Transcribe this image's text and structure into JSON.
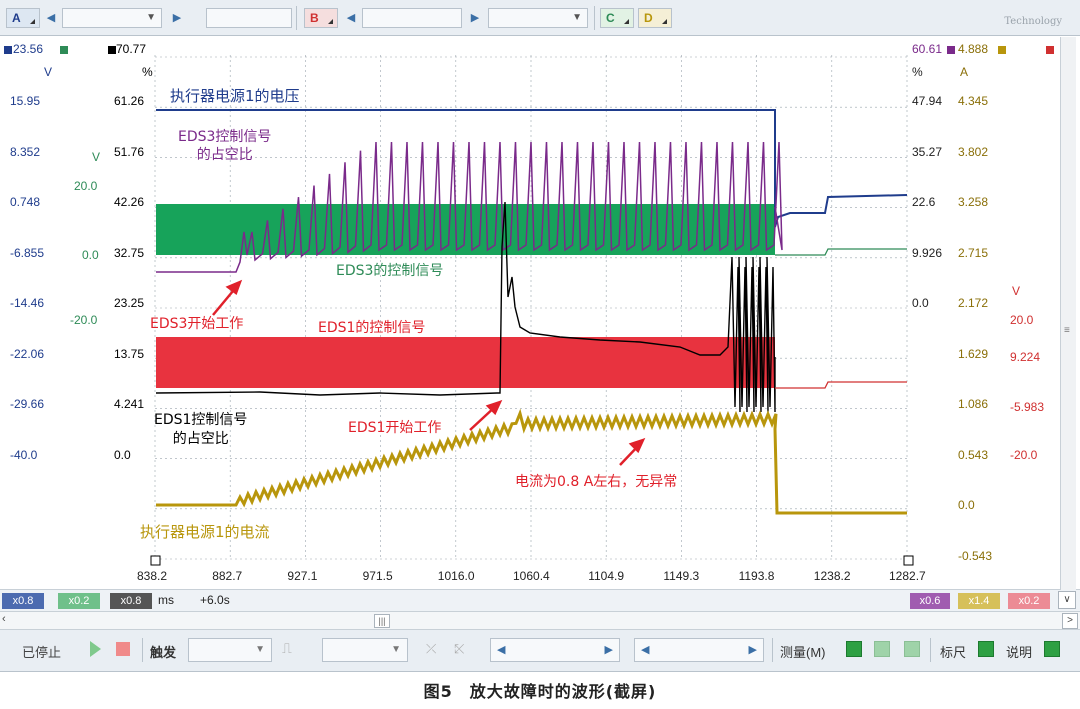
{
  "toolbar": {
    "ch_a": "A",
    "ch_b": "B",
    "ch_c": "C",
    "ch_d": "D",
    "brand": "Technology"
  },
  "axes": {
    "left1": {
      "unit": "V",
      "top": "23.56",
      "ticks": [
        "15.95",
        "8.352",
        "0.748",
        "-6.855",
        "-14.46",
        "-22.06",
        "-29.66",
        "-40.0"
      ],
      "color": "#1f3c8c"
    },
    "left2": {
      "unit": "V",
      "ticks": [
        "20.0",
        "0.0",
        "-20.0"
      ],
      "color": "#2e8b57"
    },
    "left3": {
      "unit": "%",
      "top": "70.77",
      "ticks": [
        "61.26",
        "51.76",
        "42.26",
        "32.75",
        "23.25",
        "13.75",
        "4.241",
        "0.0"
      ],
      "color": "#000000"
    },
    "right1": {
      "unit": "%",
      "top": "60.61",
      "ticks": [
        "47.94",
        "35.27",
        "22.6",
        "9.926",
        "0.0"
      ],
      "color": "#7a2a8a"
    },
    "right2": {
      "unit": "A",
      "top": "4.888",
      "ticks": [
        "4.345",
        "3.802",
        "3.258",
        "2.715",
        "2.172",
        "1.629",
        "1.086",
        "0.543",
        "0.0",
        "-0.543"
      ],
      "color": "#b8960c"
    },
    "right3": {
      "unit": "V",
      "ticks": [
        "20.0",
        "9.224",
        "-5.983",
        "-20.0"
      ],
      "color": "#d03030"
    },
    "x": {
      "ticks": [
        "838.2",
        "882.7",
        "927.1",
        "971.5",
        "1016.0",
        "1060.4",
        "1104.9",
        "1149.3",
        "1193.8",
        "1238.2",
        "1282.7"
      ]
    }
  },
  "annotations": {
    "voltage": "执行器电源1的电压",
    "eds3_duty": "EDS3控制信号\n的占空比",
    "eds3_ctrl": "EDS3的控制信号",
    "eds3_start": "EDS3开始工作",
    "eds1_ctrl": "EDS1的控制信号",
    "eds1_duty": "EDS1控制信号\n的占空比",
    "eds1_start": "EDS1开始工作",
    "current_note": "电流为0.8 A左右，无异常",
    "current": "执行器电源1的电流"
  },
  "statusbar": {
    "chips": [
      "x0.8",
      "x0.2",
      "x0.8"
    ],
    "unit": "ms",
    "offset": "+6.0s",
    "right_chips": [
      "x0.6",
      "x1.4",
      "x0.2"
    ]
  },
  "controls": {
    "stopped": "已停止",
    "trigger": "触发",
    "measure": "测量(M)",
    "ruler": "标尺",
    "help": "说明"
  },
  "caption": "图5　放大故障时的波形(截屏)",
  "colors": {
    "blue": "#1f3c8c",
    "green": "#2e8b57",
    "green_band": "#17a35a",
    "red_band": "#e8333f",
    "purple": "#7a2a8a",
    "gold": "#b8960c",
    "red": "#d03030"
  }
}
